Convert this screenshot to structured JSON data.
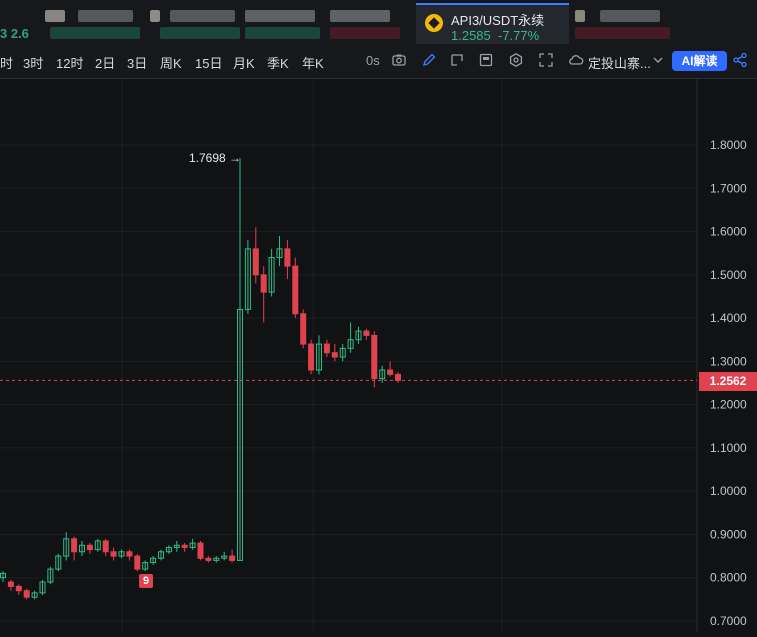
{
  "ticker": {
    "left_partial_text": "3 2.6",
    "active": {
      "pair": "API3/USDT永续",
      "price": "1.2585",
      "change": "-7.77%"
    }
  },
  "toolbar": {
    "intervals": [
      "时",
      "3时",
      "12时",
      "2日",
      "3日",
      "周K",
      "15日",
      "月K",
      "季K",
      "年K"
    ],
    "countdown": "0s",
    "strategy_label": "定投山寨...",
    "ai_button": "AI解读",
    "icons": [
      "camera-icon",
      "pencil-icon",
      "cursor-icon",
      "layout-icon",
      "settings-icon",
      "fullscreen-icon",
      "cloud-icon",
      "chevron-down-icon",
      "share-icon"
    ]
  },
  "chart": {
    "high_label": "1.7698",
    "current_price_label": "1.2562",
    "marker_label": "9",
    "up_color": "#2fbd85",
    "down_color": "#e0434f"
  },
  "chart_data": {
    "type": "candlestick",
    "y_ticks": [
      "1.8000",
      "1.7000",
      "1.6000",
      "1.5000",
      "1.4000",
      "1.3000",
      "1.2000",
      "1.1000",
      "1.0000",
      "0.9000",
      "0.8000",
      "0.7000"
    ],
    "ylim": [
      0.7,
      1.8
    ],
    "high": 1.7698,
    "last_price": 1.2562,
    "candles": [
      [
        0.8,
        0.81,
        0.79,
        0.815
      ],
      [
        0.79,
        0.78,
        0.77,
        0.795
      ],
      [
        0.78,
        0.77,
        0.76,
        0.785
      ],
      [
        0.77,
        0.755,
        0.75,
        0.775
      ],
      [
        0.755,
        0.765,
        0.75,
        0.77
      ],
      [
        0.765,
        0.79,
        0.76,
        0.795
      ],
      [
        0.79,
        0.82,
        0.785,
        0.825
      ],
      [
        0.82,
        0.85,
        0.815,
        0.855
      ],
      [
        0.85,
        0.89,
        0.84,
        0.905
      ],
      [
        0.89,
        0.86,
        0.84,
        0.895
      ],
      [
        0.86,
        0.875,
        0.85,
        0.885
      ],
      [
        0.875,
        0.865,
        0.855,
        0.88
      ],
      [
        0.865,
        0.885,
        0.86,
        0.89
      ],
      [
        0.885,
        0.86,
        0.85,
        0.89
      ],
      [
        0.86,
        0.85,
        0.84,
        0.87
      ],
      [
        0.85,
        0.86,
        0.845,
        0.865
      ],
      [
        0.86,
        0.85,
        0.84,
        0.865
      ],
      [
        0.85,
        0.82,
        0.815,
        0.855
      ],
      [
        0.82,
        0.835,
        0.815,
        0.84
      ],
      [
        0.835,
        0.845,
        0.83,
        0.85
      ],
      [
        0.845,
        0.86,
        0.84,
        0.865
      ],
      [
        0.86,
        0.87,
        0.855,
        0.875
      ],
      [
        0.87,
        0.875,
        0.86,
        0.885
      ],
      [
        0.875,
        0.87,
        0.86,
        0.88
      ],
      [
        0.87,
        0.88,
        0.865,
        0.89
      ],
      [
        0.88,
        0.845,
        0.84,
        0.885
      ],
      [
        0.845,
        0.84,
        0.835,
        0.85
      ],
      [
        0.84,
        0.845,
        0.835,
        0.85
      ],
      [
        0.845,
        0.85,
        0.84,
        0.86
      ],
      [
        0.85,
        0.84,
        0.835,
        0.865
      ],
      [
        0.84,
        1.42,
        0.84,
        1.7698
      ],
      [
        1.42,
        1.56,
        1.41,
        1.58
      ],
      [
        1.56,
        1.5,
        1.48,
        1.61
      ],
      [
        1.5,
        1.46,
        1.39,
        1.52
      ],
      [
        1.46,
        1.54,
        1.45,
        1.56
      ],
      [
        1.54,
        1.56,
        1.52,
        1.59
      ],
      [
        1.56,
        1.52,
        1.49,
        1.58
      ],
      [
        1.52,
        1.41,
        1.4,
        1.54
      ],
      [
        1.41,
        1.34,
        1.33,
        1.42
      ],
      [
        1.34,
        1.28,
        1.27,
        1.35
      ],
      [
        1.28,
        1.34,
        1.27,
        1.36
      ],
      [
        1.34,
        1.32,
        1.31,
        1.35
      ],
      [
        1.32,
        1.31,
        1.3,
        1.34
      ],
      [
        1.31,
        1.33,
        1.3,
        1.34
      ],
      [
        1.33,
        1.35,
        1.32,
        1.39
      ],
      [
        1.35,
        1.37,
        1.34,
        1.38
      ],
      [
        1.37,
        1.36,
        1.35,
        1.375
      ],
      [
        1.36,
        1.26,
        1.24,
        1.37
      ],
      [
        1.26,
        1.28,
        1.25,
        1.29
      ],
      [
        1.28,
        1.27,
        1.265,
        1.3
      ],
      [
        1.27,
        1.2562,
        1.25,
        1.275
      ]
    ]
  }
}
